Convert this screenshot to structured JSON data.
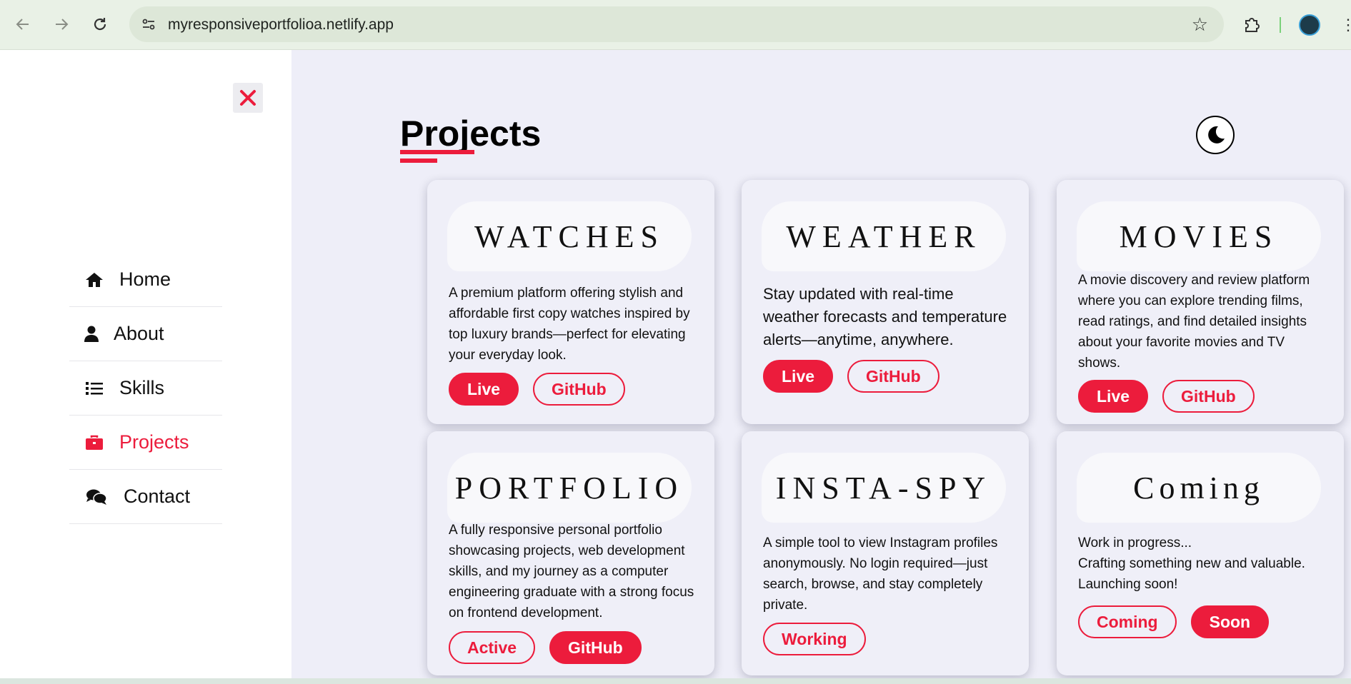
{
  "browser": {
    "url": "myresponsiveportfolioa.netlify.app",
    "icons": [
      "back-arrow-icon",
      "forward-arrow-icon",
      "reload-icon",
      "site-info-icon",
      "bookmark-star-icon",
      "extensions-icon",
      "profile-avatar",
      "more-menu-icon"
    ]
  },
  "sidebar": {
    "items": [
      {
        "label": "Home",
        "icon": "home-icon"
      },
      {
        "label": "About",
        "icon": "user-icon"
      },
      {
        "label": "Skills",
        "icon": "list-icon"
      },
      {
        "label": "Projects",
        "icon": "briefcase-icon",
        "active": true
      },
      {
        "label": "Contact",
        "icon": "comments-icon"
      }
    ]
  },
  "main": {
    "title": "Projects",
    "theme_icon": "moon-icon"
  },
  "projects": [
    {
      "title": "WATCHES",
      "description": "A premium platform offering stylish and affordable first copy watches inspired by top luxury brands—perfect for elevating your everyday look.",
      "buttons": [
        {
          "label": "Live",
          "style": "solid"
        },
        {
          "label": "GitHub",
          "style": "outline"
        }
      ]
    },
    {
      "title": "WEATHER",
      "description": "Stay updated with real-time weather forecasts and temperature alerts—anytime, anywhere.",
      "buttons": [
        {
          "label": "Live",
          "style": "solid"
        },
        {
          "label": "GitHub",
          "style": "outline"
        }
      ]
    },
    {
      "title": "MOVIES",
      "description": "A movie discovery and review platform where you can explore trending films, read ratings, and find detailed insights about your favorite movies and TV shows.",
      "buttons": [
        {
          "label": "Live",
          "style": "solid"
        },
        {
          "label": "GitHub",
          "style": "outline"
        }
      ]
    },
    {
      "title": "PORTFOLIO",
      "description": "A fully responsive personal portfolio showcasing projects, web development skills, and my journey as a computer engineering graduate with a strong focus on frontend development.",
      "buttons": [
        {
          "label": "Active",
          "style": "outline"
        },
        {
          "label": "GitHub",
          "style": "solid"
        }
      ]
    },
    {
      "title": "INSTA-SPY",
      "description": "A simple tool to view Instagram profiles anonymously. No login required—just search, browse, and stay completely private.",
      "buttons": [
        {
          "label": "Working",
          "style": "outline"
        }
      ]
    },
    {
      "title": "Coming",
      "description_lines": [
        "Work in progress...",
        "Crafting something new and valuable.",
        "Launching soon!"
      ],
      "buttons": [
        {
          "label": "Coming",
          "style": "outline"
        },
        {
          "label": "Soon",
          "style": "solid"
        }
      ]
    }
  ],
  "colors": {
    "accent": "#ec1c3c",
    "main_bg": "#eeeef8",
    "card_bg": "#efeff8",
    "chrome_bg": "#e9f1e6"
  }
}
